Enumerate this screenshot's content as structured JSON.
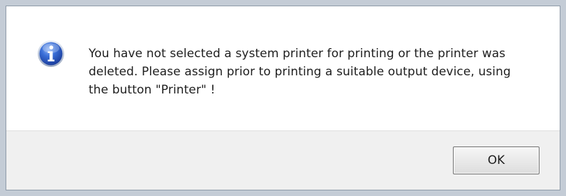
{
  "dialog": {
    "icon": "info-icon",
    "message": "You have not selected a system printer for printing or the printer was deleted. Please assign prior to printing a suitable output device, using the button \"Printer\" !",
    "ok_label": "OK",
    "accent_color": "#2f63c9"
  }
}
